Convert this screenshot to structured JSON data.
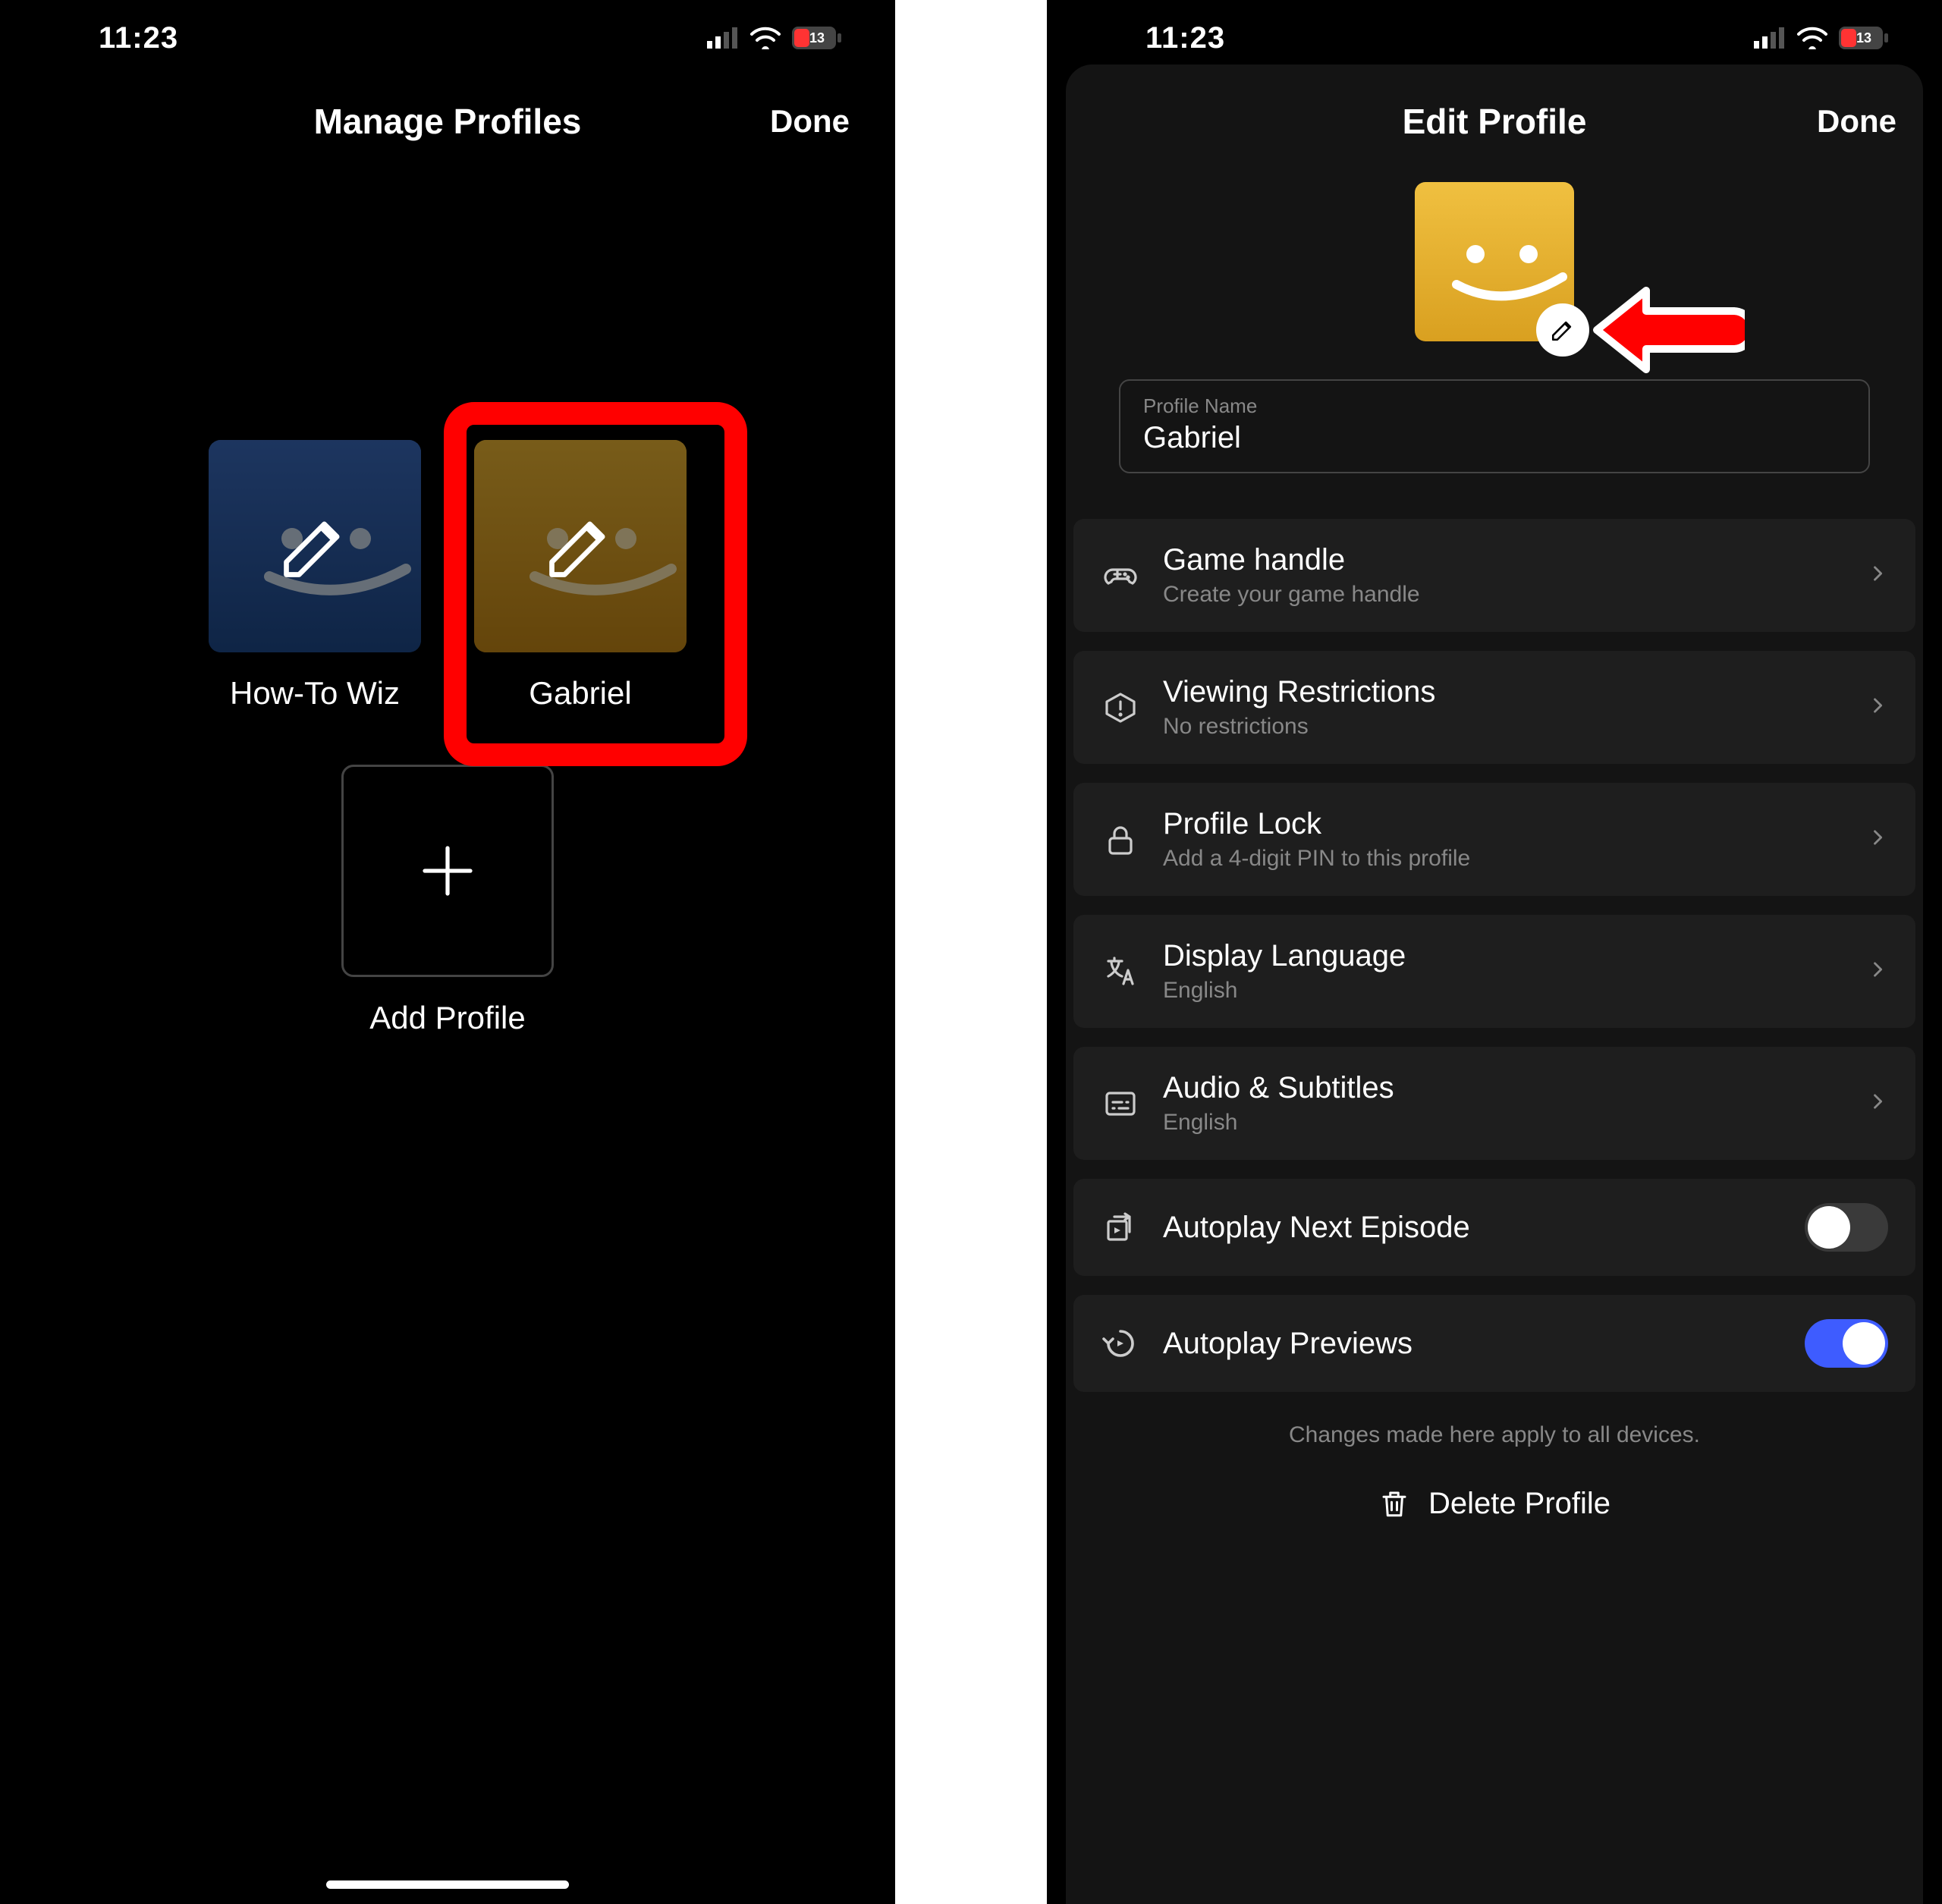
{
  "status": {
    "time": "11:23",
    "battery": "13"
  },
  "left": {
    "title": "Manage Profiles",
    "done": "Done",
    "profiles": [
      {
        "name": "How-To Wiz"
      },
      {
        "name": "Gabriel"
      }
    ],
    "add_label": "Add Profile"
  },
  "right": {
    "title": "Edit Profile",
    "done": "Done",
    "name_label": "Profile Name",
    "name_value": "Gabriel",
    "settings": [
      {
        "title": "Game handle",
        "sub": "Create your game handle",
        "icon": "gamepad",
        "type": "link"
      },
      {
        "title": "Viewing Restrictions",
        "sub": "No restrictions",
        "icon": "warn",
        "type": "link"
      },
      {
        "title": "Profile Lock",
        "sub": "Add a 4-digit PIN to this profile",
        "icon": "lock",
        "type": "link"
      },
      {
        "title": "Display Language",
        "sub": "English",
        "icon": "lang",
        "type": "link"
      },
      {
        "title": "Audio & Subtitles",
        "sub": "English",
        "icon": "subtitles",
        "type": "link"
      },
      {
        "title": "Autoplay Next Episode",
        "sub": "",
        "icon": "next",
        "type": "toggle",
        "on": false
      },
      {
        "title": "Autoplay Previews",
        "sub": "",
        "icon": "replay",
        "type": "toggle",
        "on": true
      }
    ],
    "footer": "Changes made here apply to all devices.",
    "delete": "Delete Profile"
  }
}
